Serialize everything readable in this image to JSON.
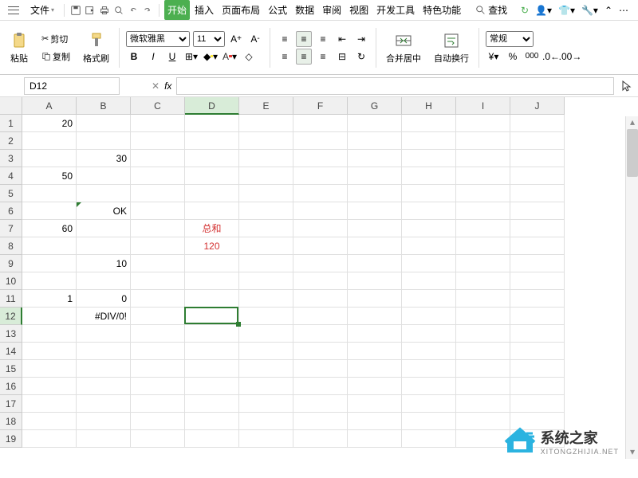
{
  "menubar": {
    "file": "文件",
    "tabs": [
      "开始",
      "插入",
      "页面布局",
      "公式",
      "数据",
      "审阅",
      "视图",
      "开发工具",
      "特色功能"
    ],
    "active_tab": 0,
    "search": "查找"
  },
  "ribbon": {
    "paste": "粘贴",
    "cut": "剪切",
    "copy": "复制",
    "format_painter": "格式刷",
    "font_name": "微软雅黑",
    "font_size": "11",
    "merge_center": "合并居中",
    "auto_wrap": "自动换行",
    "number_format": "常规"
  },
  "namebox": {
    "cell_ref": "D12",
    "formula": ""
  },
  "columns": [
    "A",
    "B",
    "C",
    "D",
    "E",
    "F",
    "G",
    "H",
    "I",
    "J"
  ],
  "rows": [
    "1",
    "2",
    "3",
    "4",
    "5",
    "6",
    "7",
    "8",
    "9",
    "10",
    "11",
    "12",
    "13",
    "14",
    "15",
    "16",
    "17",
    "18",
    "19"
  ],
  "active_col": 3,
  "active_row": 11,
  "cells": {
    "A1": "20",
    "B3": "30",
    "A4": "50",
    "B6": "OK",
    "A7": "60",
    "D7": {
      "value": "总和",
      "red": true,
      "center": true
    },
    "D8": {
      "value": "120",
      "red": true,
      "center": true
    },
    "B9": "10",
    "A11": "1",
    "B11": "0",
    "B12": "#DIV/0!"
  },
  "watermark": {
    "title": "系统之家",
    "sub": "XITONGZHIJIA.NET"
  },
  "chart_data": {
    "type": "table",
    "title": "Spreadsheet cell data",
    "cells": [
      {
        "ref": "A1",
        "value": 20
      },
      {
        "ref": "B3",
        "value": 30
      },
      {
        "ref": "A4",
        "value": 50
      },
      {
        "ref": "B6",
        "value": "OK"
      },
      {
        "ref": "A7",
        "value": 60
      },
      {
        "ref": "D7",
        "value": "总和"
      },
      {
        "ref": "D8",
        "value": 120
      },
      {
        "ref": "B9",
        "value": 10
      },
      {
        "ref": "A11",
        "value": 1
      },
      {
        "ref": "B11",
        "value": 0
      },
      {
        "ref": "B12",
        "value": "#DIV/0!"
      }
    ]
  }
}
